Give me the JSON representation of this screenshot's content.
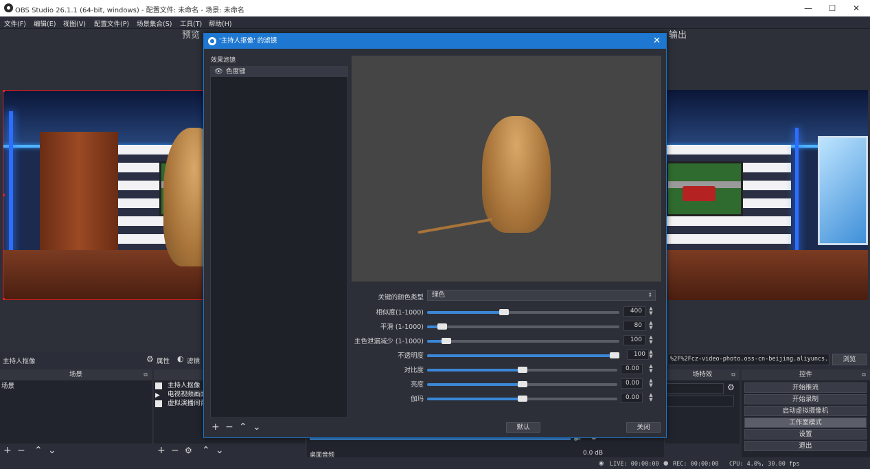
{
  "window": {
    "title": "OBS Studio 26.1.1 (64-bit, windows) - 配置文件: 未命名 - 场景: 未命名",
    "minimize": "—",
    "maximize": "☐",
    "close": "✕"
  },
  "menu": [
    "文件(F)",
    "编辑(E)",
    "视图(V)",
    "配置文件(P)",
    "场景集合(S)",
    "工具(T)",
    "帮助(H)"
  ],
  "workspace": {
    "preview_label": "预览",
    "program_label": "输出"
  },
  "source_bar": {
    "selected_source": "主持人抠像",
    "properties_label": "属性",
    "filters_label": "滤镜",
    "url_text": "%2F%2Fcz-video-photo.oss-cn-beijing.aliyuncs.jfif",
    "browse_label": "浏览"
  },
  "scenes": {
    "title": "场景",
    "items": [
      "场景"
    ]
  },
  "sources": {
    "items": [
      "主持人抠像",
      "电视视频画面",
      "虚拟演播间背景"
    ]
  },
  "mixer": {
    "channel": "桌面音频",
    "level": "0.0 dB"
  },
  "transitions": {
    "title": "场特效"
  },
  "controls": {
    "title": "控件",
    "buttons": [
      "开始推流",
      "开始录制",
      "启动虚拟摄像机",
      "工作室模式",
      "设置",
      "退出"
    ]
  },
  "status": {
    "live": "LIVE: 00:00:00",
    "rec": "REC: 00:00:00",
    "cpu": "CPU: 4.0%, 30.00 fps"
  },
  "dialog": {
    "title": "'主持人抠像' 的滤镜",
    "effects_label": "效果滤镜",
    "filter_item": "色度键",
    "key_color_label": "关键的颜色类型",
    "key_color_value": "绿色",
    "defaults_label": "默认",
    "close_label": "关闭",
    "properties": [
      {
        "label": "相似度(1-1000)",
        "value": "400",
        "fraction": 0.4
      },
      {
        "label": "平滑 (1-1000)",
        "value": "80",
        "fraction": 0.08
      },
      {
        "label": "主色泄漏减少 (1-1000)",
        "value": "100",
        "fraction": 0.1
      },
      {
        "label": "不透明度",
        "value": "100",
        "fraction": 1.0
      },
      {
        "label": "对比度",
        "value": "0.00",
        "fraction": 0.5
      },
      {
        "label": "亮度",
        "value": "0.00",
        "fraction": 0.5
      },
      {
        "label": "伽玛",
        "value": "0.00",
        "fraction": 0.5
      }
    ]
  }
}
